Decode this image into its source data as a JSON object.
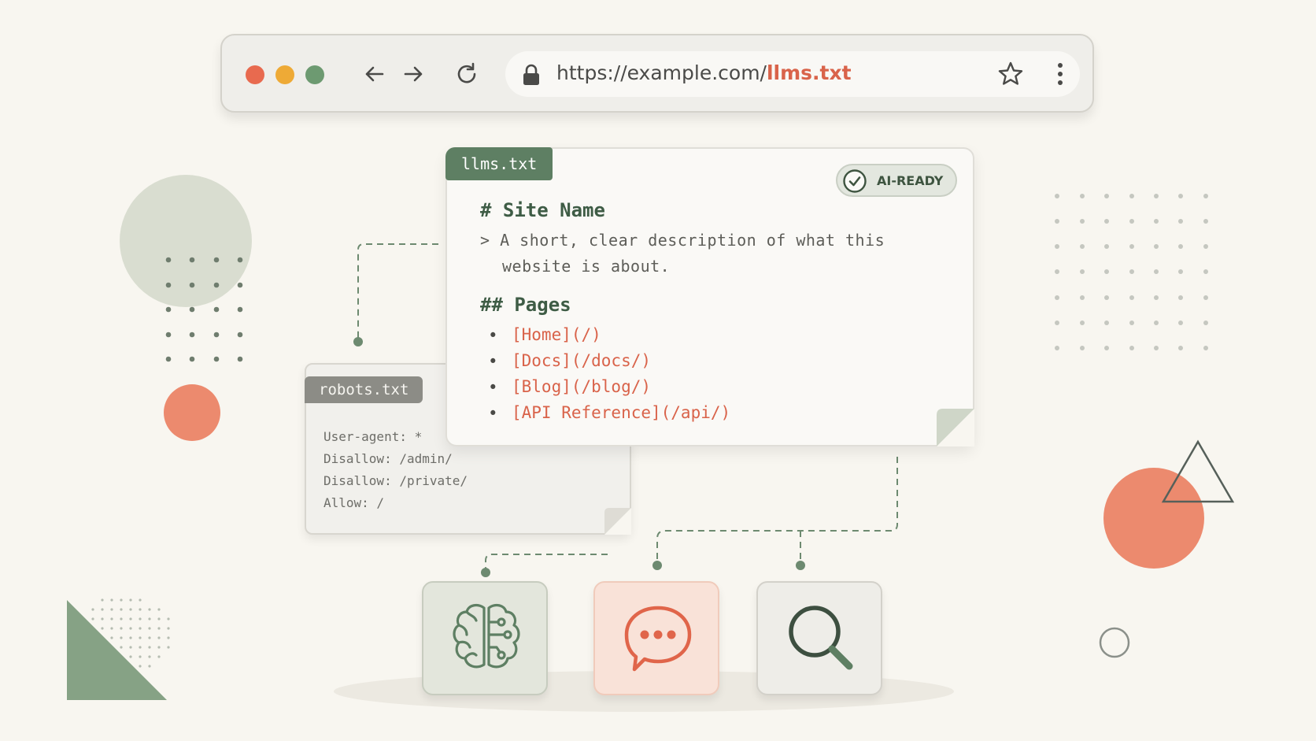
{
  "browser": {
    "url_base": "https://example.com/",
    "url_file": "llms.txt",
    "icons": [
      "back-arrow-icon",
      "forward-arrow-icon",
      "reload-icon",
      "lock-icon",
      "star-icon",
      "more-vertical-icon"
    ]
  },
  "llms_doc": {
    "tab_label": "llms.txt",
    "badge_label": "AI-READY",
    "heading": "# Site Name",
    "description_line1": "> A short, clear description of what this",
    "description_line2": "website is about.",
    "section_heading": "## Pages",
    "links": [
      "[Home](/)",
      "[Docs](/docs/)",
      "[Blog](/blog/)",
      "[API Reference](/api/)"
    ]
  },
  "robots_doc": {
    "tab_label": "robots.txt",
    "lines": [
      "User-agent: *",
      "Disallow: /admin/",
      "Disallow: /private/",
      "Allow: /"
    ]
  },
  "consumers": [
    {
      "icon": "brain-icon"
    },
    {
      "icon": "chat-bubble-icon"
    },
    {
      "icon": "search-icon"
    }
  ],
  "colors": {
    "background": "#f8f6f0",
    "green": "#5e7f63",
    "coral": "#d9634a",
    "sage": "#d8dccd"
  }
}
